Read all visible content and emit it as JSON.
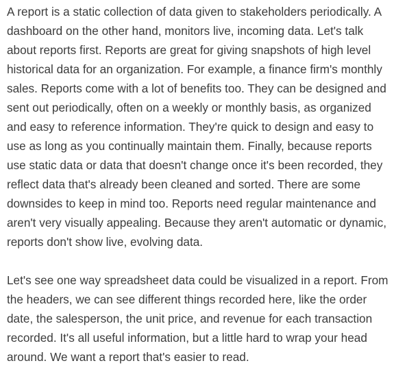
{
  "document": {
    "paragraphs": [
      "A report is a static collection of data given to stakeholders periodically. A dashboard on the other hand, monitors live, incoming data. Let's talk about reports first. Reports are great for giving snapshots of high level historical data for an organization. For example, a finance firm's monthly sales. Reports come with a lot of benefits too. They can be designed and sent out periodically, often on a weekly or monthly basis, as organized and easy to reference information. They're quick to design and easy to use as long as you continually maintain them. Finally, because reports use static data or data that doesn't change once it's been recorded, they reflect data that's already been cleaned and sorted. There are some downsides to keep in mind too. Reports need regular maintenance and aren't very visually appealing. Because they aren't automatic or dynamic, reports don't show live, evolving data.",
      "Let's see one way spreadsheet data could be visualized in a report. From the headers, we can see different things recorded here, like the order date, the salesperson, the unit price, and revenue for each transaction recorded. It's all useful information, but a little hard to wrap your head around. We want a report that's easier to read."
    ]
  }
}
